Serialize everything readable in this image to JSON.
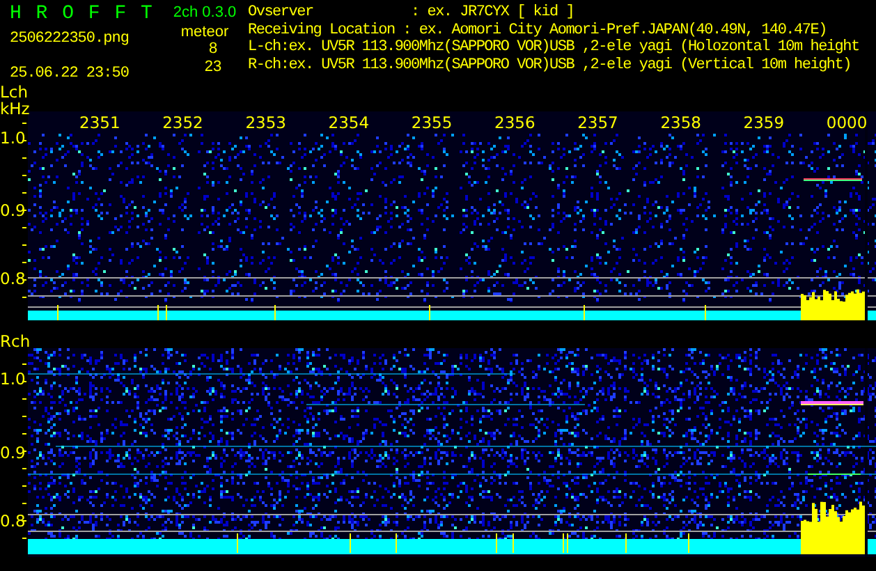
{
  "header": {
    "app_name": "H R O F F T",
    "version": "2ch 0.3.0",
    "filename": "2506222350.png",
    "timestamp": "25.06.22 23:50",
    "meteor_label": "meteor",
    "counts": [
      "8",
      "23"
    ],
    "info_lines": [
      "Ovserver            : ex. JR7CYX [ kid ]",
      "Receiving Location : ex. Aomori City Aomori-Pref.JAPAN(40.49N, 140.47E)",
      "L-ch:ex. UV5R 113.900Mhz(SAPPORO VOR)USB ,2-ele yagi (Holozontal 10m height",
      "R-ch:ex. UV5R 113.900Mhz(SAPPORO VOR)USB ,2-ele yagi (Vertical 10m height)"
    ]
  },
  "panels": [
    {
      "channel": "Lch",
      "unit": "kHz",
      "time_labels": [
        "2351",
        "2352",
        "2353",
        "2354",
        "2355",
        "2356",
        "2357",
        "2358",
        "2359",
        "0000"
      ],
      "freq_labels": [
        "1.0",
        "0.9",
        "0.8"
      ]
    },
    {
      "channel": "Rch",
      "freq_labels": [
        "1.0",
        "0.9",
        "0.8"
      ]
    }
  ]
}
